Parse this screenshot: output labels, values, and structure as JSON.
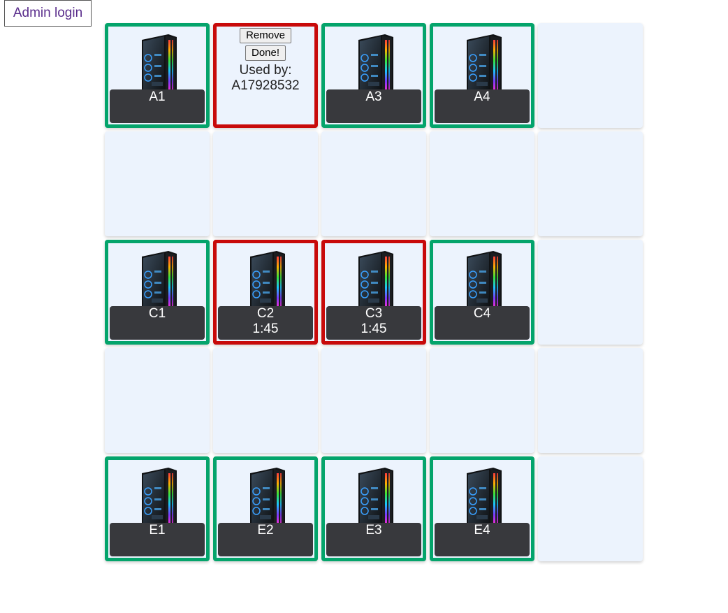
{
  "admin_login": "Admin login",
  "colors": {
    "available_border": "#04a46b",
    "in_use_border": "#c80a0a",
    "empty_cell_bg": "#ecf3fd",
    "label_bar_bg": "#38393d",
    "admin_text": "#5a2d8c"
  },
  "icons": {
    "computer": "gaming-pc-tower-icon"
  },
  "grid": {
    "columns": 5,
    "cells": [
      {
        "status": "available",
        "name": "A1"
      },
      {
        "status": "in-use-panel",
        "remove_label": "Remove",
        "done_label": "Done!",
        "used_by_label": "Used by:",
        "used_by_id": "A17928532"
      },
      {
        "status": "available",
        "name": "A3"
      },
      {
        "status": "available",
        "name": "A4"
      },
      {
        "status": "empty"
      },
      {
        "status": "empty"
      },
      {
        "status": "empty"
      },
      {
        "status": "empty"
      },
      {
        "status": "empty"
      },
      {
        "status": "empty"
      },
      {
        "status": "available",
        "name": "C1"
      },
      {
        "status": "in-use",
        "name": "C2",
        "timer": "1:45"
      },
      {
        "status": "in-use",
        "name": "C3",
        "timer": "1:45"
      },
      {
        "status": "available",
        "name": "C4"
      },
      {
        "status": "empty"
      },
      {
        "status": "empty"
      },
      {
        "status": "empty"
      },
      {
        "status": "empty"
      },
      {
        "status": "empty"
      },
      {
        "status": "empty"
      },
      {
        "status": "available",
        "name": "E1"
      },
      {
        "status": "available",
        "name": "E2"
      },
      {
        "status": "available",
        "name": "E3"
      },
      {
        "status": "available",
        "name": "E4"
      },
      {
        "status": "empty"
      }
    ]
  }
}
